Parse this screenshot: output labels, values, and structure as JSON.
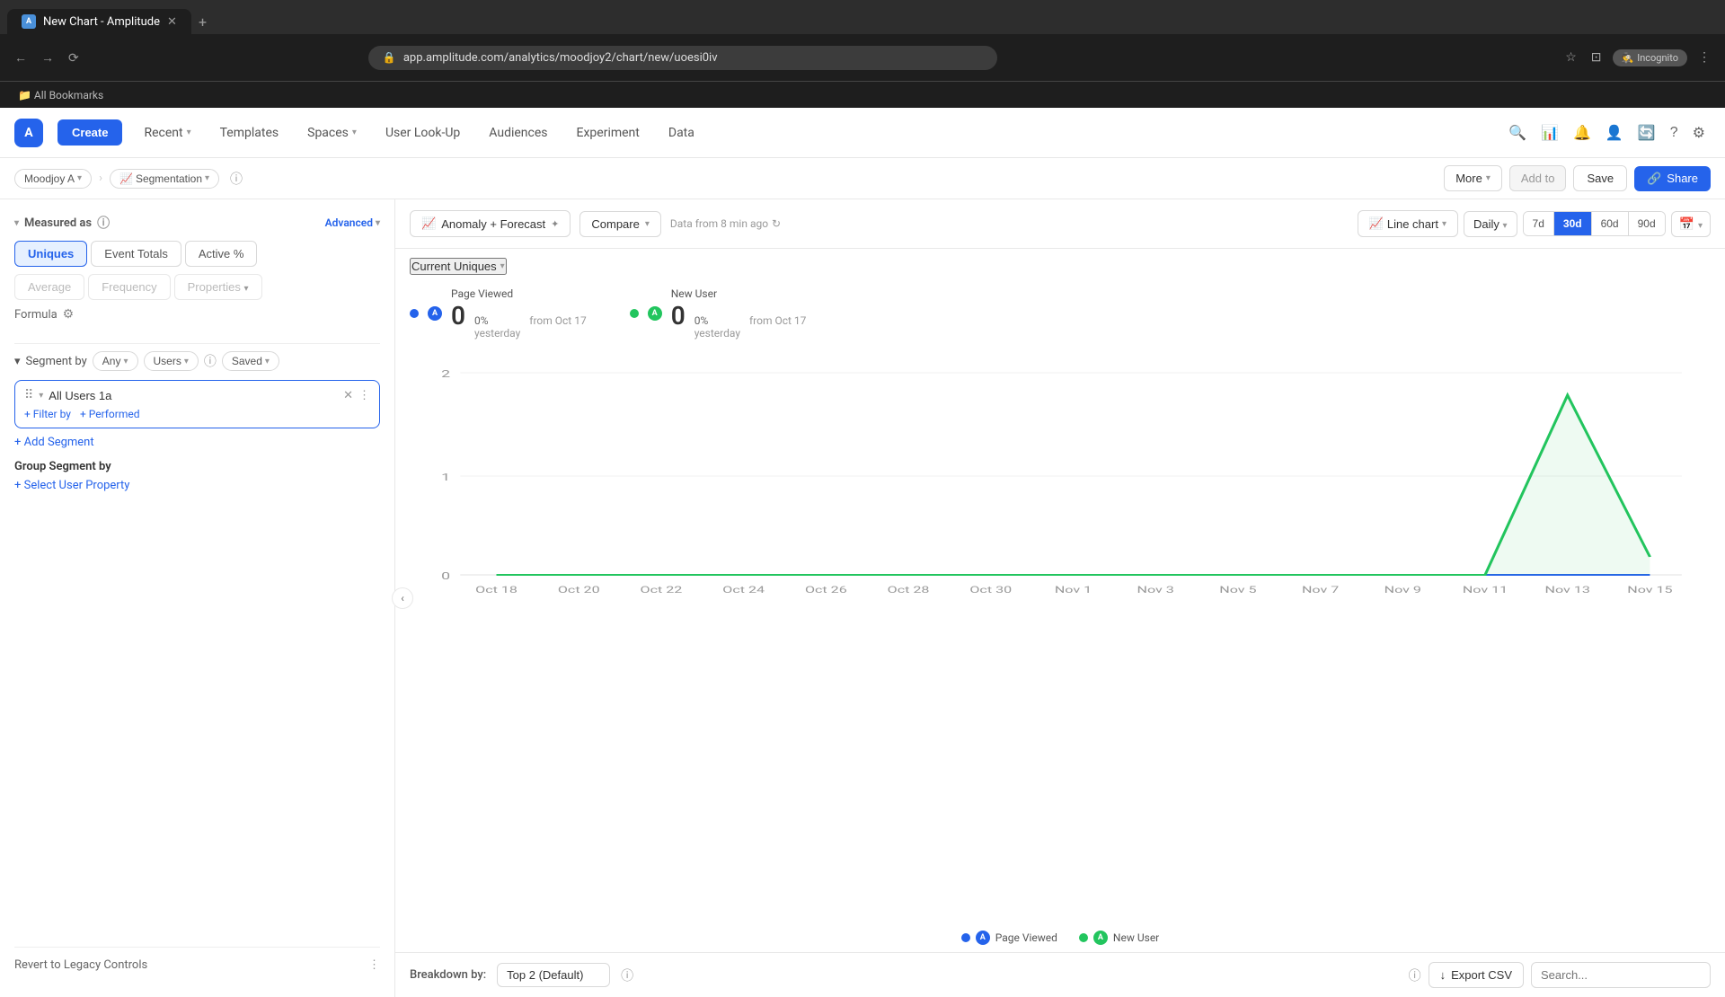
{
  "browser": {
    "tab_title": "New Chart - Amplitude",
    "url": "app.amplitude.com/analytics/moodjoy2/chart/new/uoesi0iv",
    "incognito_label": "Incognito",
    "bookmarks_label": "All Bookmarks"
  },
  "header": {
    "logo": "A",
    "create_label": "Create",
    "nav_items": [
      "Recent",
      "Templates",
      "Spaces",
      "User Look-Up",
      "Audiences",
      "Experiment",
      "Data"
    ],
    "workspace_name": "Moodjoy A",
    "chart_type": "Segmentation"
  },
  "left_panel": {
    "measured_as_label": "Measured as",
    "advanced_label": "Advanced",
    "buttons": {
      "uniques": "Uniques",
      "event_totals": "Event Totals",
      "active_pct": "Active %",
      "average": "Average",
      "frequency": "Frequency",
      "properties": "Properties"
    },
    "formula_label": "Formula",
    "segment_by_label": "Segment by",
    "any_label": "Any",
    "users_label": "Users",
    "saved_label": "Saved",
    "segment_value": "All Users 1a",
    "filter_by_label": "+ Filter by",
    "performed_label": "+ Performed",
    "add_segment_label": "+ Add Segment",
    "group_segment_label": "Group Segment by",
    "select_user_property": "+ Select User Property",
    "revert_label": "Revert to Legacy Controls"
  },
  "chart": {
    "anomaly_btn": "Anomaly + Forecast",
    "compare_btn": "Compare",
    "data_info": "Data from 8 min ago",
    "line_chart_label": "Line chart",
    "daily_label": "Daily",
    "date_ranges": [
      "7d",
      "30d",
      "60d",
      "90d"
    ],
    "active_range": "30d",
    "current_uniques_label": "Current Uniques",
    "metrics": [
      {
        "color": "#2563eb",
        "icon_bg": "#2563eb",
        "icon_letter": "A",
        "title": "Page Viewed",
        "value": "0",
        "change": "0%",
        "change_label": "yesterday",
        "from_label": "from Oct 17"
      },
      {
        "color": "#22c55e",
        "icon_bg": "#22c55e",
        "icon_letter": "A",
        "title": "New User",
        "value": "0",
        "change": "0%",
        "change_label": "yesterday",
        "from_label": "from Oct 17"
      }
    ],
    "y_axis_max": "2",
    "y_axis_mid": "1",
    "y_axis_min": "0",
    "x_axis_labels": [
      "Oct 18",
      "Oct 20",
      "Oct 22",
      "Oct 24",
      "Oct 26",
      "Oct 28",
      "Oct 30",
      "Nov 1",
      "Nov 3",
      "Nov 5",
      "Nov 7",
      "Nov 9",
      "Nov 11",
      "Nov 13",
      "Nov 15"
    ],
    "legend": [
      {
        "color": "#2563eb",
        "icon_bg": "#2563eb",
        "icon_letter": "A",
        "label": "Page Viewed"
      },
      {
        "color": "#22c55e",
        "icon_bg": "#22c55e",
        "icon_letter": "A",
        "label": "New User"
      }
    ]
  },
  "toolbar": {
    "more_label": "More",
    "add_to_label": "Add to",
    "save_label": "Save",
    "share_label": "Share"
  },
  "bottom": {
    "breakdown_label": "Breakdown by:",
    "breakdown_value": "Top 2 (Default)",
    "export_label": "Export CSV"
  }
}
